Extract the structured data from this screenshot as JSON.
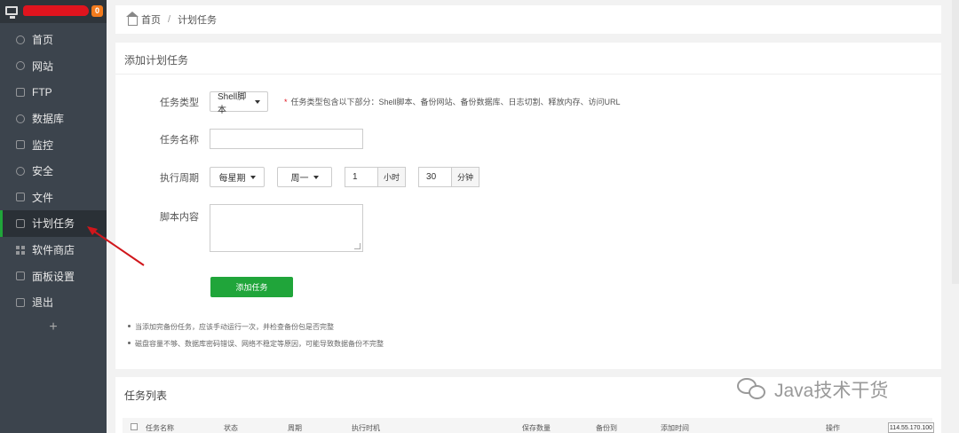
{
  "sidebar": {
    "badge": "0",
    "items": [
      {
        "label": "首页",
        "icon": "home-icon"
      },
      {
        "label": "网站",
        "icon": "globe-icon"
      },
      {
        "label": "FTP",
        "icon": "ftp-icon"
      },
      {
        "label": "数据库",
        "icon": "database-icon"
      },
      {
        "label": "监控",
        "icon": "monitor-icon"
      },
      {
        "label": "安全",
        "icon": "shield-icon"
      },
      {
        "label": "文件",
        "icon": "folder-icon"
      },
      {
        "label": "计划任务",
        "icon": "calendar-icon"
      },
      {
        "label": "软件商店",
        "icon": "grid-icon"
      },
      {
        "label": "面板设置",
        "icon": "settings-icon"
      },
      {
        "label": "退出",
        "icon": "logout-icon"
      }
    ],
    "active_index": 7,
    "add": "+"
  },
  "breadcrumb": {
    "home": "首页",
    "sep": "/",
    "current": "计划任务"
  },
  "form": {
    "title": "添加计划任务",
    "type_label": "任务类型",
    "type_value": "Shell脚本",
    "type_hint_star": "*",
    "type_hint": "任务类型包含以下部分：Shell脚本、备份网站、备份数据库、日志切割、释放内存、访问URL",
    "name_label": "任务名称",
    "name_value": "",
    "period_label": "执行周期",
    "period_value": "每星期",
    "weekday_value": "周一",
    "hour_value": "1",
    "hour_unit": "小时",
    "minute_value": "30",
    "minute_unit": "分钟",
    "script_label": "脚本内容",
    "submit": "添加任务",
    "notes": [
      "当添加完备份任务，应该手动运行一次，并检查备份包是否完整",
      "磁盘容量不够、数据库密码错误、网络不稳定等原因，可能导致数据备份不完整"
    ]
  },
  "task_list": {
    "title": "任务列表",
    "columns": [
      "任务名称",
      "状态",
      "周期",
      "执行时机",
      "保存数量",
      "备份到",
      "添加时间",
      "操作"
    ],
    "ip": "114.55.170.100"
  },
  "watermark": "Java技术干货",
  "colors": {
    "accent": "#20a53a",
    "sidebar": "#3c444d",
    "badge": "#f37b1d",
    "annotation": "#d0161b"
  }
}
